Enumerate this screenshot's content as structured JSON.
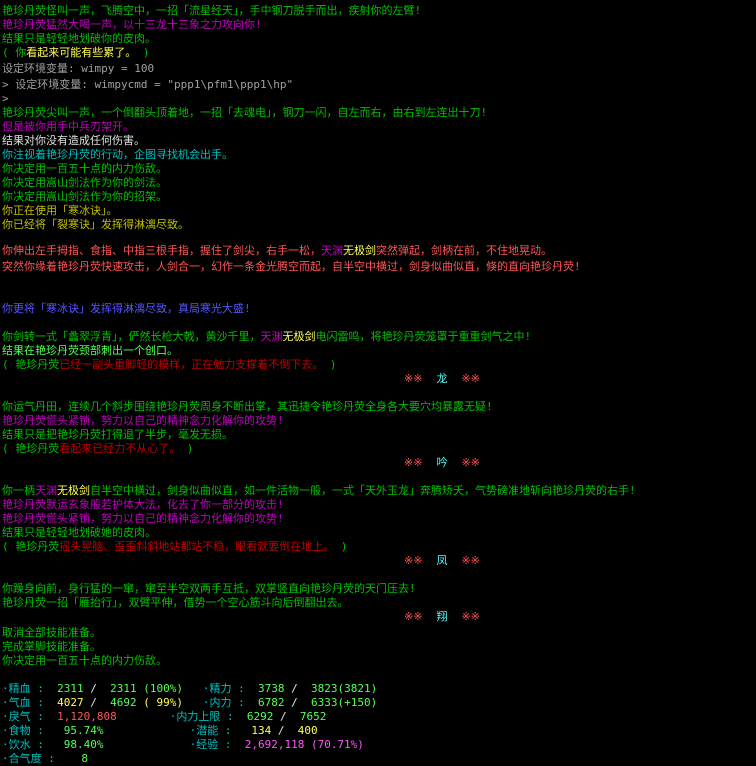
{
  "colors": {
    "background": "#000000",
    "green": "#00c000",
    "magenta": "#c000c0",
    "red": "#c00000",
    "yellow": "#c0c000",
    "cyan": "#00c0c0",
    "blue": "#5555ff",
    "gray": "#a0a0a0"
  },
  "log": {
    "l1": "艳珍丹荧怪叫一声，飞腾空中，一招「流星经天」，手中钢刀脱手而出，疾射你的左臂!",
    "l2": "艳珍丹荧猛然大喝一声，以十三龙十三象之力攻向你!",
    "l3": "结果只是轻轻地划破你的皮肉。",
    "l4a": "( 你",
    "l4b": "看起来可能有些累了。",
    "l4c": " )",
    "l5": "设定环境变量: wimpy = 100",
    "l6": "> 设定环境变量: wimpycmd = \"ppp1\\pfm1\\ppp1\\hp\"",
    "l7": ">",
    "l8": "艳珍丹荧尖叫一声，一个倒翻头顶着地，一招「去魂电」，钢刀一闪，自左而右，由右到左连出十刀!",
    "l9": "但是被你用手中兵刃架开。",
    "l10": "结果对你没有造成任何伤害。",
    "l11": "你注视着艳珍丹荧的行动，企图寻找机会出手。",
    "l12": "你决定用一百五十点的内力伤敌。",
    "l13": "你决定用嵩山剑法作为你的剑法。",
    "l14": "你决定用嵩山剑法作为你的招架。",
    "l15": "你正在使用「寒冰诀」。",
    "l16": "你已经将「裂寒诀」发挥得淋漓尽致。",
    "l17a": "你伸出左手拇指、食指、中指三根手指，握住了剑尖，右手一松，",
    "l17b": "天渊",
    "l17c": "无极剑",
    "l17d": "突然弹起，剑柄在前，不住地晃动。",
    "l18": "突然你缘着艳珍丹荧快速攻击，人剑合一，幻作一条金光腾空而起，自半空中横过，剑身似曲似直，倏的直向艳珍丹荧!",
    "l19": "你更将「寒冰诀」发挥得淋漓尽致，真局寒光大盛!",
    "l20a": "你剑转一式「蠡翠浮青」，俨然长枪大戟，黄沙千里，",
    "l20b": "天渊",
    "l20c": "无极剑",
    "l20d": "电闪雷鸣，将艳珍丹荧笼罩于重重剑气之中!",
    "l21": "结果在艳珍丹荧颈部刺出一个创口。",
    "l22a": "( 艳珍丹荧",
    "l22b": "已经一副头重脚轻的模样，正在勉力支撑着不倒下去。",
    "l22c": " )",
    "c1a": "※※",
    "c1b": "龙",
    "c1c": "※※",
    "l23": "你运气丹田，连续几个斜步围绕艳珍丹荧周身不断出掌，其迅捷令艳珍丹荧全身各大要穴均暴露无疑!",
    "l24": "艳珍丹荧慌头紧锁，努力以自己的精神念力化解你的攻势!",
    "l25": "结果只是把艳珍丹荧打得退了半步，毫发无损。",
    "l26a": "( 艳珍丹荧",
    "l26b": "看起来已经力不从心了。",
    "l26c": " )",
    "c2a": "※※",
    "c2b": "吟",
    "c2c": "※※",
    "l27a": "你一柄",
    "l27b": "天渊",
    "l27c": "无极剑",
    "l27d": "自半空中横过，剑身似曲似直，如一件活物一般，一式「天外玉龙」奔腾矫夭，气势磅准地斩向艳珍丹荧的右手!",
    "l28": "艳珍丹荧默运玄象般若护体大法，化去了你一部分的攻击!",
    "l29": "艳珍丹荧慌头紧锁，努力以自己的精神念力化解你的攻势!",
    "l30": "结果只是轻轻地划破她的皮肉。",
    "l31a": "( 艳珍丹荧",
    "l31b": "摇头晃脑、歪歪斜斜地站都站不稳，眼看就要倒在地上。",
    "l31c": " )",
    "c3a": "※※",
    "c3b": "凤",
    "c3c": "※※",
    "l32": "你躁身向前，身行猛的一窜，窜至半空双两手互抵，双掌竖直向艳珍丹荧的天门压去!",
    "l33": "艳珍丹荧一招「雁抬行」，双臂平伸，借势一个空心筋斗向后倒翻出去。",
    "c4a": "※※",
    "c4b": "翔",
    "c4c": "※※",
    "l34": "取消全部技能准备。",
    "l35": "完成掌脚技能准备。",
    "l36": "你决定用一百五十点的内力伤敌。"
  },
  "status": {
    "jingxue_label": "·精血 :",
    "jingxue_cur": "2311",
    "jingxue_max": "2311",
    "jingxue_pct": "(100%)",
    "jingli_label": "·精力 :",
    "jingli_cur": "3738",
    "jingli_max": "3823(3821)",
    "qixue_label": "·气血 :",
    "qixue_cur": "4027",
    "qixue_max": "4692",
    "qixue_pct": "( 99%)",
    "neili_label": "·内力 :",
    "neili_cur": "6782",
    "neili_max": "6333(+150)",
    "lqi_label": "·戾气 :",
    "lqi_val": "1,120,808",
    "neili_limit_label": "·内力上限 :",
    "neili_limit_cur": "6292",
    "neili_limit_max": "7652",
    "food_label": "·食物 :",
    "food_val": "95.74%",
    "qianneng_label": "·潜能 :",
    "qianneng_cur": "134",
    "qianneng_max": "400",
    "water_label": "·饮水 :",
    "water_val": "98.40%",
    "exp_label": "·经验 :",
    "exp_val": "2,692,118 (70.71%)",
    "heqi_label": "·合气度 :",
    "heqi_val": "8"
  }
}
